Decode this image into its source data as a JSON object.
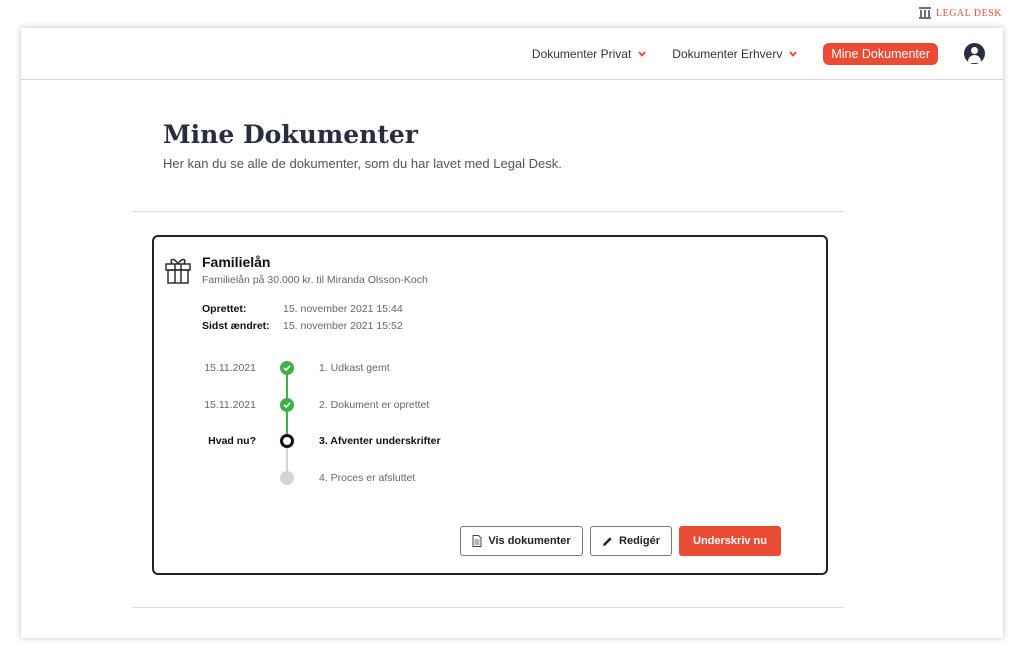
{
  "brand": {
    "name": "LEGAL DESK",
    "icon": "pillars-logo-icon"
  },
  "nav": {
    "items": [
      {
        "label": "Dokumenter Privat",
        "icon": "chevron-down-icon"
      },
      {
        "label": "Dokumenter Erhverv",
        "icon": "chevron-down-icon"
      }
    ],
    "active": "Mine Dokumenter",
    "avatar_icon": "user-icon"
  },
  "page": {
    "title": "Mine Dokumenter",
    "subtitle": "Her kan du se alle de dokumenter, som du har lavet med Legal Desk."
  },
  "document": {
    "icon": "gift-icon",
    "title": "Familielån",
    "subtitle": "Familielån på 30.000 kr. til Miranda Olsson-Koch",
    "meta": [
      {
        "label": "Oprettet:",
        "value": "15. november 2021 15:44"
      },
      {
        "label": "Sidst ændret:",
        "value": "15. november 2021 15:52"
      }
    ],
    "steps": [
      {
        "date": "15.11.2021",
        "label": "1. Udkast gemt",
        "status": "done"
      },
      {
        "date": "15.11.2021",
        "label": "2. Dokument er oprettet",
        "status": "done"
      },
      {
        "date": "Hvad nu?",
        "label": "3. Afventer underskrifter",
        "status": "current"
      },
      {
        "date": "",
        "label": "4. Proces er afsluttet",
        "status": "pending"
      }
    ],
    "buttons": {
      "view": "Vis dokumenter",
      "edit": "Redigér",
      "sign": "Underskriv nu"
    }
  },
  "colors": {
    "accent": "#ea4b35",
    "done": "#3db049",
    "pending": "#d4d4d4",
    "dark": "#2a2d3e"
  }
}
